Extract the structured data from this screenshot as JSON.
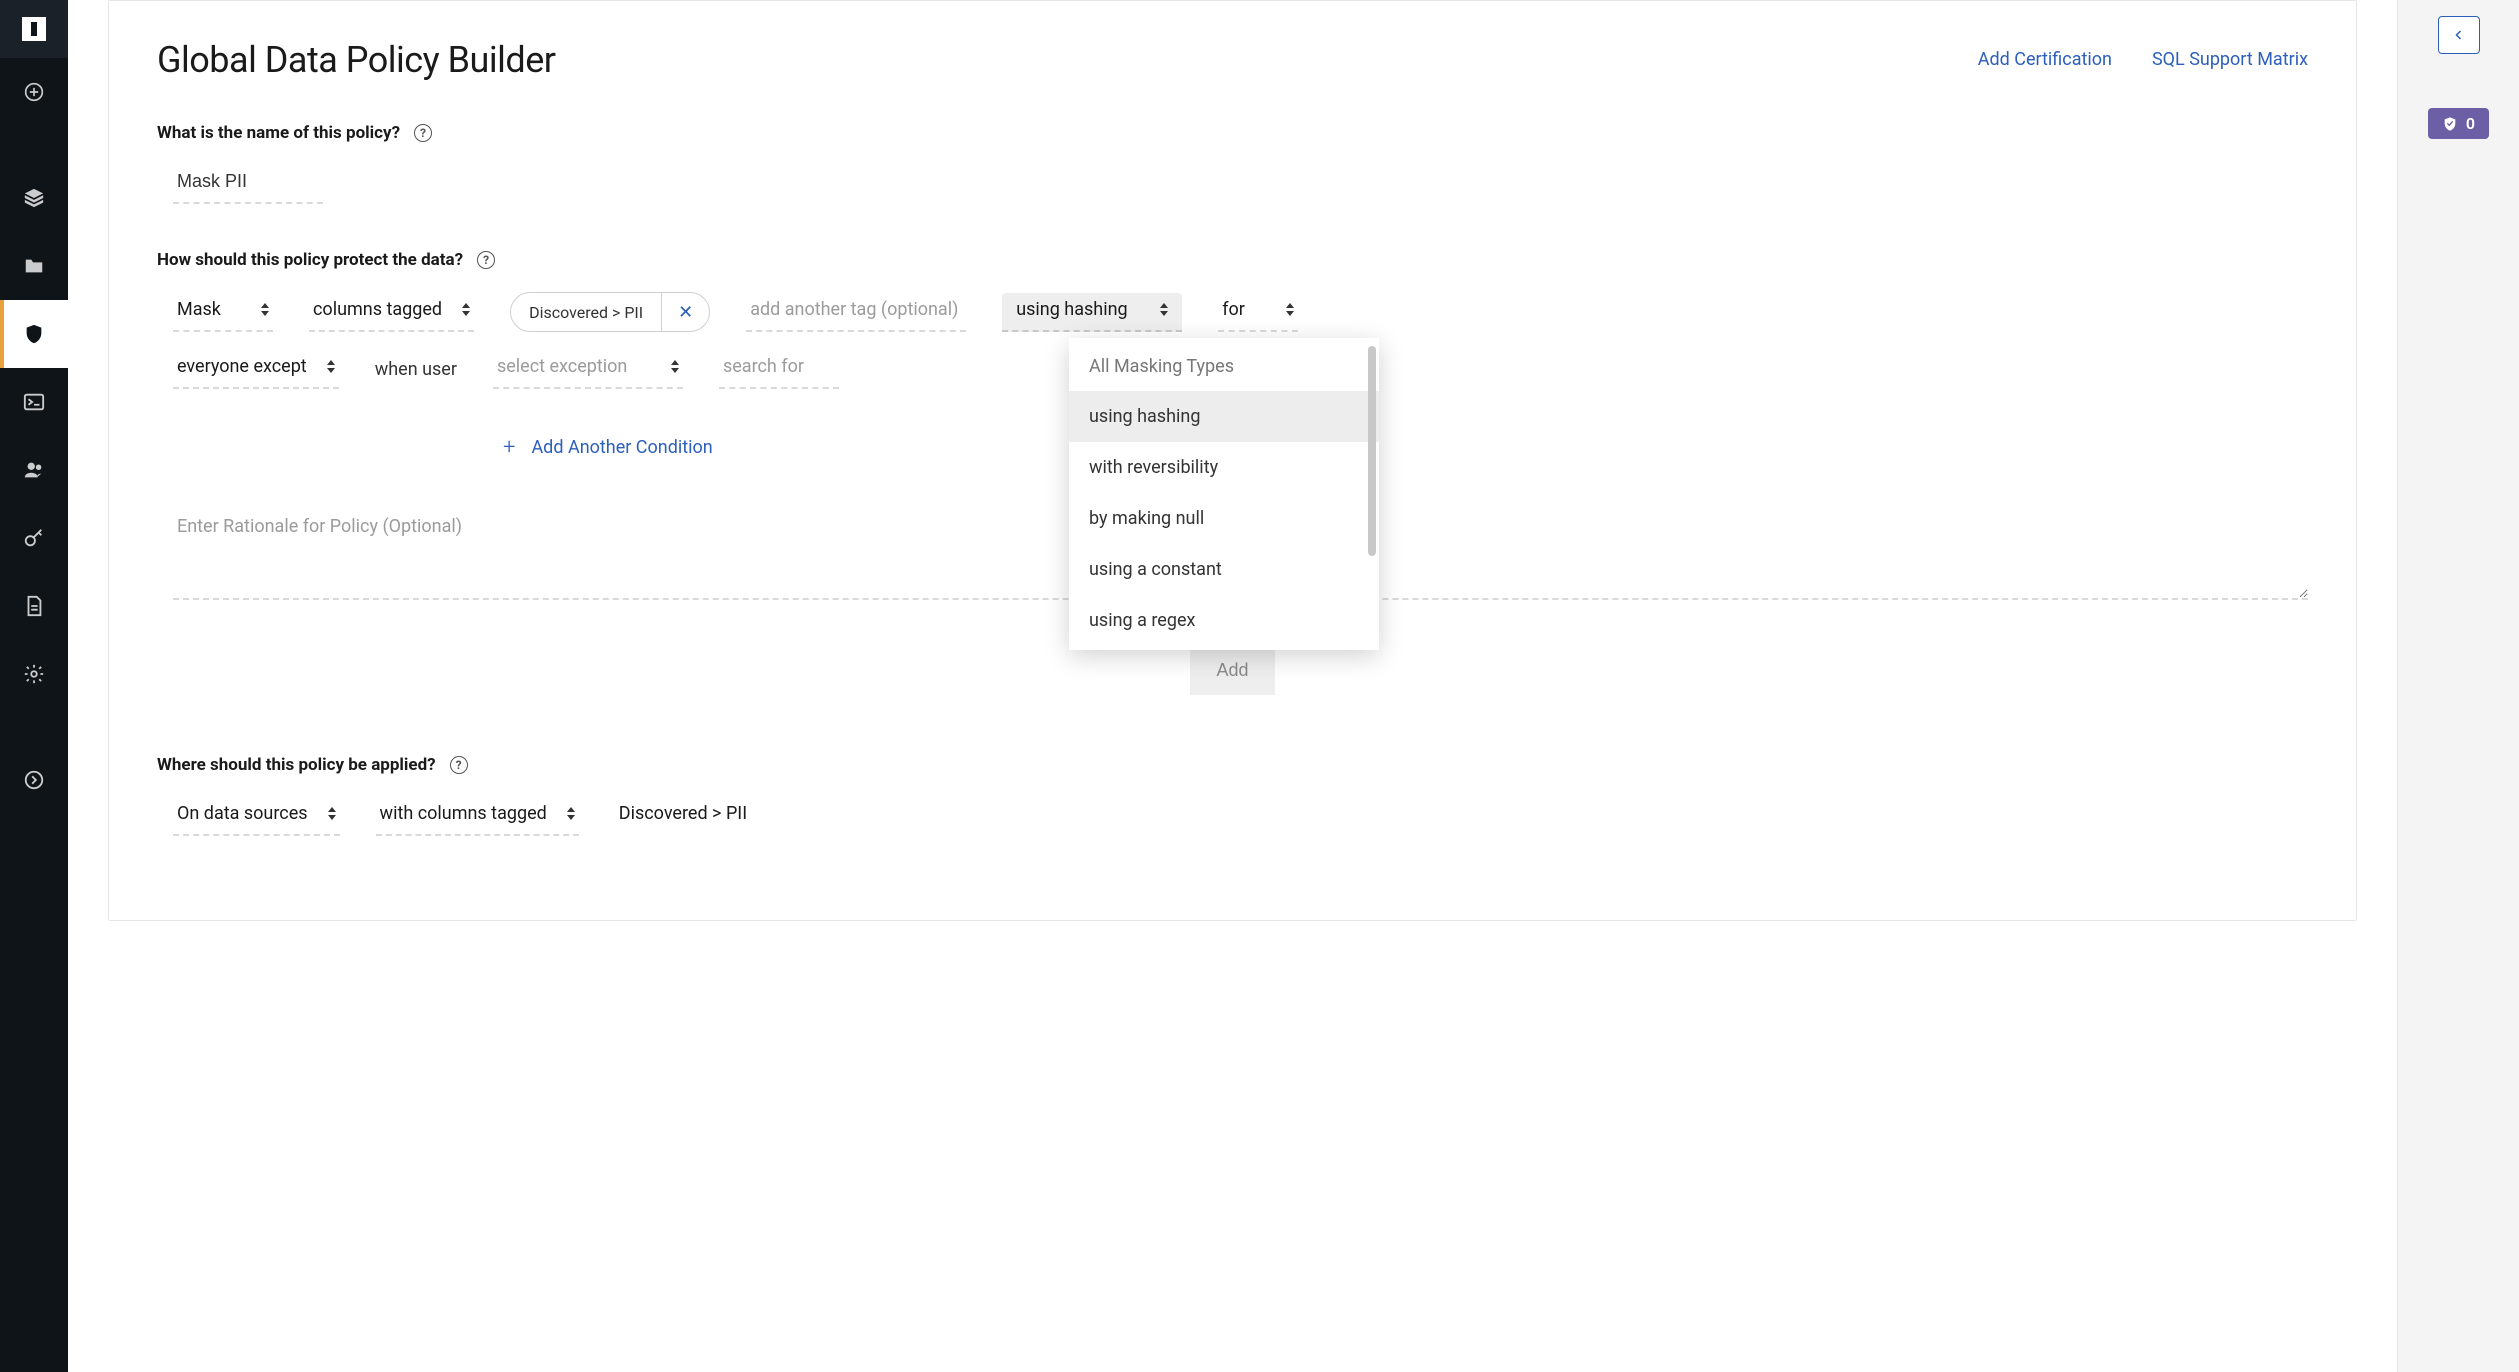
{
  "header": {
    "title": "Global Data Policy Builder",
    "links": {
      "add_certification": "Add Certification",
      "sql_support": "SQL Support Matrix"
    }
  },
  "right_panel": {
    "badge_count": "0"
  },
  "sections": {
    "name": {
      "label": "What is the name of this policy?",
      "value": "Mask PII"
    },
    "protect": {
      "label": "How should this policy protect the data?",
      "row1": {
        "action": "Mask",
        "target": "columns tagged",
        "tag": "Discovered > PII",
        "add_tag_placeholder": "add another tag (optional)",
        "masking_type": "using hashing",
        "for_label": "for"
      },
      "row2": {
        "scope": "everyone except",
        "when": "when user",
        "exception_placeholder": "select exception",
        "search_placeholder": "search for"
      },
      "add_condition": "Add Another Condition",
      "rationale_placeholder": "Enter Rationale for Policy (Optional)",
      "add_button": "Add",
      "dropdown": {
        "header": "All Masking Types",
        "items": [
          "using hashing",
          "with reversibility",
          "by making null",
          "using a constant",
          "using a regex"
        ],
        "selected_index": 0
      }
    },
    "apply": {
      "label": "Where should this policy be applied?",
      "target1": "On data sources",
      "target2": "with columns tagged",
      "tag": "Discovered > PII"
    }
  }
}
